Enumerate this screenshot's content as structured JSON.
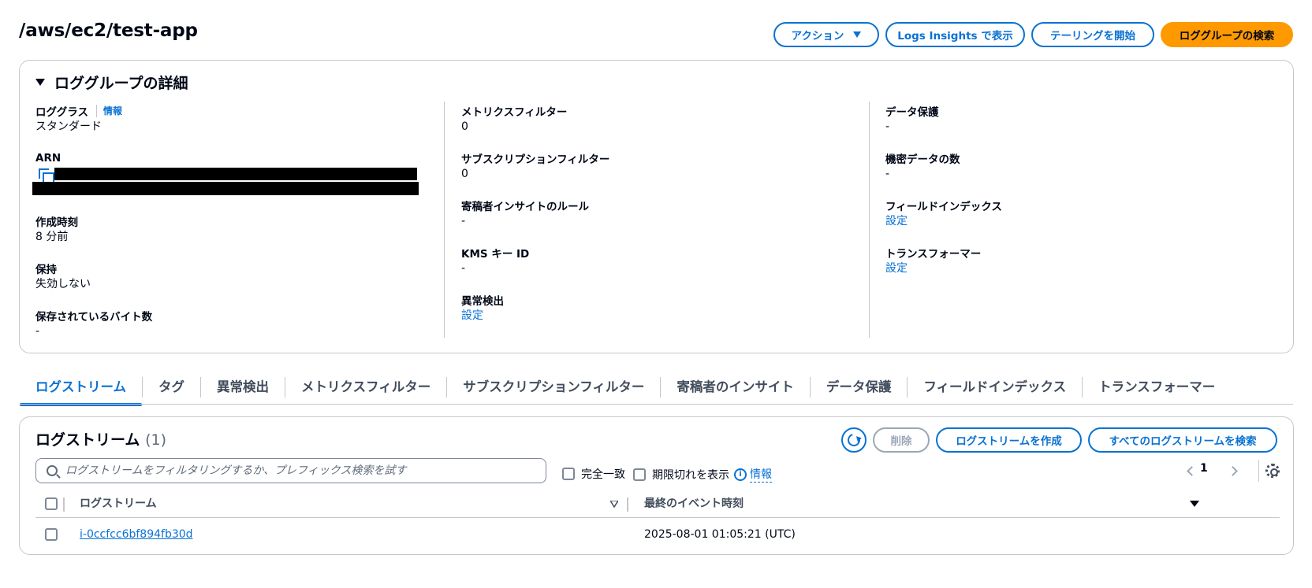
{
  "header": {
    "title": "/aws/ec2/test-app",
    "actions_label": "アクション",
    "logs_insights_label": "Logs Insights で表示",
    "tailing_label": "テーリングを開始",
    "search_group_label": "ロググループの検索"
  },
  "details": {
    "heading": "ロググループの詳細",
    "col1": {
      "log_class_label": "ロググラス",
      "log_class_info": "情報",
      "log_class_value": "スタンダード",
      "arn_label": "ARN",
      "created_label": "作成時刻",
      "created_value": "8 分前",
      "retention_label": "保持",
      "retention_value": "失効しない",
      "stored_bytes_label": "保存されているバイト数",
      "stored_bytes_value": "-"
    },
    "col2": {
      "metric_filters_label": "メトリクスフィルター",
      "metric_filters_value": "0",
      "subscription_filters_label": "サブスクリプションフィルター",
      "subscription_filters_value": "0",
      "contributor_rules_label": "寄稿者インサイトのルール",
      "contributor_rules_value": "-",
      "kms_label": "KMS キー ID",
      "kms_value": "-",
      "anomaly_label": "異常検出",
      "anomaly_link": "設定"
    },
    "col3": {
      "data_protection_label": "データ保護",
      "data_protection_value": "-",
      "sensitive_count_label": "機密データの数",
      "sensitive_count_value": "-",
      "field_index_label": "フィールドインデックス",
      "field_index_link": "設定",
      "transformer_label": "トランスフォーマー",
      "transformer_link": "設定"
    }
  },
  "tabs": [
    {
      "label": "ログストリーム",
      "active": true
    },
    {
      "label": "タグ"
    },
    {
      "label": "異常検出"
    },
    {
      "label": "メトリクスフィルター"
    },
    {
      "label": "サブスクリプションフィルター"
    },
    {
      "label": "寄稿者のインサイト"
    },
    {
      "label": "データ保護"
    },
    {
      "label": "フィールドインデックス"
    },
    {
      "label": "トランスフォーマー"
    }
  ],
  "streams": {
    "title": "ログストリーム",
    "count": "(1)",
    "delete_label": "削除",
    "create_label": "ログストリームを作成",
    "search_all_label": "すべてのログストリームを検索",
    "search_placeholder": "ログストリームをフィルタリングするか、プレフィックス検索を試す",
    "exact_match_label": "完全一致",
    "show_expired_label": "期限切れを表示",
    "info_label": "情報",
    "page": "1",
    "columns": [
      "ログストリーム",
      "最終のイベント時刻"
    ],
    "rows": [
      {
        "name": "i-0ccfcc6bf894fb30d",
        "last_event": "2025-08-01 01:05:21 (UTC)"
      }
    ]
  },
  "colors": {
    "accent": "#0972d3",
    "primary_button": "#ff9900",
    "border": "#c6c6cd"
  }
}
